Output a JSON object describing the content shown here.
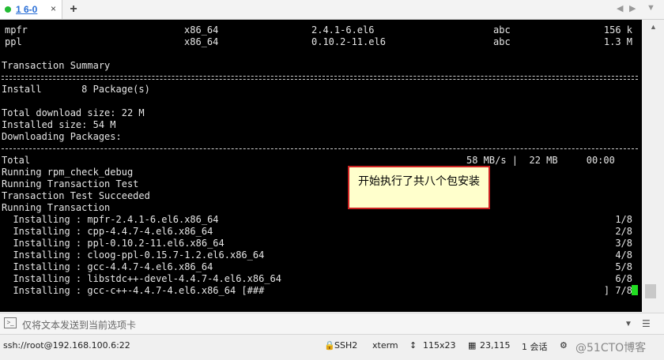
{
  "tab": {
    "label": "1 6-0",
    "close": "×"
  },
  "add_tab": "+",
  "nav": {
    "left": "◀",
    "right": "▶",
    "menu": "▼"
  },
  "terminal": {
    "pkg_rows": [
      {
        "name": "mpfr",
        "arch": "x86_64",
        "version": "2.4.1-6.el6",
        "repo": "abc",
        "size": "156 k"
      },
      {
        "name": "ppl",
        "arch": "x86_64",
        "version": "0.10.2-11.el6",
        "repo": "abc",
        "size": "1.3 M"
      }
    ],
    "transaction_summary": "Transaction Summary",
    "install_line": "Install       8 Package(s)",
    "total_download": "Total download size: 22 M",
    "installed_size": "Installed size: 54 M",
    "downloading": "Downloading Packages:",
    "total_label": "Total",
    "total_stats": "58 MB/s |  22 MB     00:00",
    "running_lines": [
      "Running rpm_check_debug",
      "Running Transaction Test",
      "Transaction Test Succeeded",
      "Running Transaction"
    ],
    "installing": [
      {
        "text": "  Installing : mpfr-2.4.1-6.el6.x86_64",
        "count": "1/8"
      },
      {
        "text": "  Installing : cpp-4.4.7-4.el6.x86_64",
        "count": "2/8"
      },
      {
        "text": "  Installing : ppl-0.10.2-11.el6.x86_64",
        "count": "3/8"
      },
      {
        "text": "  Installing : cloog-ppl-0.15.7-1.2.el6.x86_64",
        "count": "4/8"
      },
      {
        "text": "  Installing : gcc-4.4.7-4.el6.x86_64",
        "count": "5/8"
      },
      {
        "text": "  Installing : libstdc++-devel-4.4.7-4.el6.x86_64",
        "count": "6/8"
      },
      {
        "text": "  Installing : gcc-c++-4.4.7-4.el6.x86_64 [###",
        "count": "] 7/8"
      }
    ]
  },
  "callout": {
    "text": "开始执行了共八个包安装"
  },
  "compose": {
    "placeholder": "仅将文本发送到当前选项卡",
    "icon": "keyboard-icon"
  },
  "status": {
    "connection": "ssh://root@192.168.100.6:22",
    "protocol": "SSH2",
    "term": "xterm",
    "size": "115x23",
    "cursor_pos": "23,115",
    "sessions": "1 会话",
    "watermark": "@51CTO博客"
  },
  "colors": {
    "cursor": "#22dd22",
    "callout_border": "#cc2222",
    "callout_bg": "#ffffcc",
    "tab_dot": "#22bb33"
  }
}
